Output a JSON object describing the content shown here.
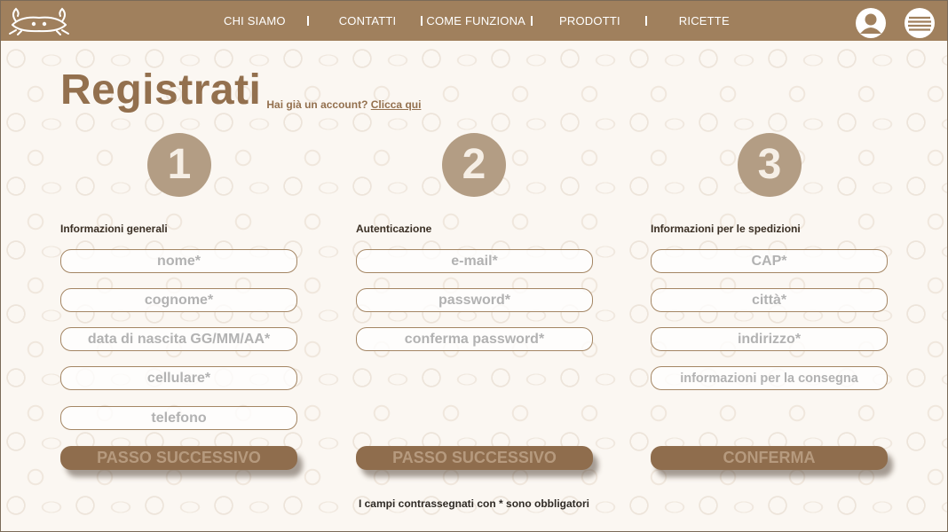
{
  "header": {
    "nav": [
      "CHI SIAMO",
      "CONTATTI",
      "COME FUNZIONA",
      "PRODOTTI",
      "RICETTE"
    ],
    "logo_icon": "crab-icon",
    "user_icon": "user-avatar-icon",
    "menu_icon": "hamburger-menu-icon"
  },
  "page": {
    "title": "Registrati",
    "login_prompt": "Hai già un account?",
    "login_link": "Clicca qui"
  },
  "steps": [
    {
      "number": "1",
      "title": "Informazioni generali",
      "fields": [
        "nome*",
        "cognome*",
        "data di nascita GG/MM/AA*",
        "cellulare*",
        "telefono"
      ],
      "button": "PASSO SUCCESSIVO"
    },
    {
      "number": "2",
      "title": "Autenticazione",
      "fields": [
        "e-mail*",
        "password*",
        "conferma password*"
      ],
      "button": "PASSO SUCCESSIVO"
    },
    {
      "number": "3",
      "title": "Informazioni per le spedizioni",
      "fields": [
        "CAP*",
        "città*",
        "indirizzo*",
        "informazioni per la consegna"
      ],
      "button": "CONFERMA"
    }
  ],
  "footnote": "I campi contrassegnati con * sono obbligatori",
  "colors": {
    "header": "#a0805d",
    "accent": "#93704e",
    "step_circle": "#b39d84",
    "button": "#8f6d4d"
  }
}
